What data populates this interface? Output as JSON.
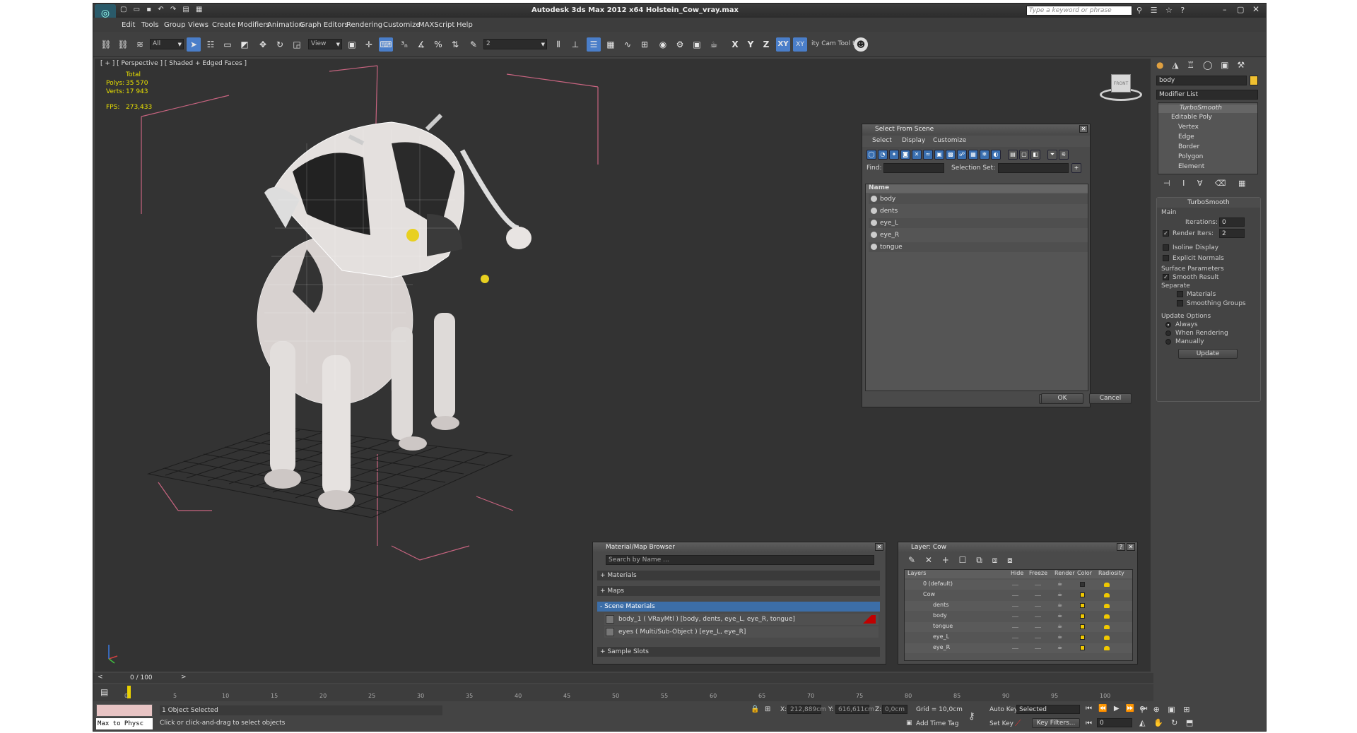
{
  "titlebar": {
    "title": "Autodesk 3ds Max  2012 x64     Holstein_Cow_vray.max",
    "search_placeholder": "Type a keyword or phrase"
  },
  "menu": [
    "Edit",
    "Tools",
    "Group",
    "Views",
    "Create",
    "Modifiers",
    "Animation",
    "Graph Editors",
    "Rendering",
    "Customize",
    "MAXScript",
    "Help"
  ],
  "toolbar": {
    "selection_filter": "All",
    "ref_coord": "View",
    "spinner_snap": "2",
    "axes": [
      "X",
      "Y",
      "Z",
      "XY",
      "XY"
    ],
    "cam_tool": "ity Cam Tool t"
  },
  "viewport": {
    "label": "[ + ] [ Perspective ] [ Shaded + Edged Faces ]",
    "stats": {
      "header": "Total",
      "polys_label": "Polys:",
      "polys": "35 570",
      "verts_label": "Verts:",
      "verts": "17 943",
      "fps_label": "FPS:",
      "fps": "273,433"
    },
    "viewcube_label": "FRONT"
  },
  "select_dialog": {
    "title": "Select From Scene",
    "menu": [
      "Select",
      "Display",
      "Customize"
    ],
    "find_label": "Find:",
    "find_value": "",
    "selset_label": "Selection Set:",
    "column": "Name",
    "items": [
      "body",
      "dents",
      "eye_L",
      "eye_R",
      "tongue"
    ],
    "ok": "OK",
    "cancel": "Cancel"
  },
  "material_browser": {
    "title": "Material/Map Browser",
    "search_placeholder": "Search by Name ...",
    "sections": [
      "+ Materials",
      "+ Maps",
      "- Scene Materials"
    ],
    "rows": [
      "body_1 ( VRayMtl ) [body, dents, eye_L, eye_R, tongue]",
      "eyes ( Multi/Sub-Object ) [eye_L, eye_R]"
    ],
    "sample_slots": "+ Sample Slots"
  },
  "layer_window": {
    "title": "Layer: Cow",
    "help": "?",
    "columns": [
      "Layers",
      "Hide",
      "Freeze",
      "Render",
      "Color",
      "Radiosity"
    ],
    "rows": [
      {
        "name": "0 (default)",
        "indent": 0
      },
      {
        "name": "Cow",
        "indent": 0
      },
      {
        "name": "dents",
        "indent": 1
      },
      {
        "name": "body",
        "indent": 1
      },
      {
        "name": "tongue",
        "indent": 1
      },
      {
        "name": "eye_L",
        "indent": 1
      },
      {
        "name": "eye_R",
        "indent": 1
      }
    ]
  },
  "command_panel": {
    "object_name": "body",
    "object_color": "#f0c030",
    "modifier_list": "Modifier List",
    "stack": [
      "TurboSmooth",
      "Editable Poly",
      "Vertex",
      "Edge",
      "Border",
      "Polygon",
      "Element"
    ],
    "rollout": "TurboSmooth",
    "main": "Main",
    "iterations_label": "Iterations:",
    "iterations": "0",
    "render_iters_label": "Render Iters:",
    "render_iters": "2",
    "isoline": "Isoline Display",
    "explicit": "Explicit Normals",
    "surface_params": "Surface Parameters",
    "smooth_result": "Smooth Result",
    "separate": "Separate",
    "materials": "Materials",
    "smoothing_groups": "Smoothing Groups",
    "update_options": "Update Options",
    "always": "Always",
    "when_rendering": "When Rendering",
    "manually": "Manually",
    "update": "Update"
  },
  "timeline": {
    "frame": "0 / 100",
    "ticks": [
      "0",
      "5",
      "10",
      "15",
      "20",
      "25",
      "30",
      "35",
      "40",
      "45",
      "50",
      "55",
      "60",
      "65",
      "70",
      "75",
      "80",
      "85",
      "90",
      "95",
      "100"
    ]
  },
  "statusbar": {
    "maxscript": "Max to Physc",
    "selected": "1 Object Selected",
    "prompt": "Click or click-and-drag to select objects",
    "x_label": "X:",
    "x": "212,889cm",
    "y_label": "Y:",
    "y": "616,611cm",
    "z_label": "Z:",
    "z": "0,0cm",
    "grid": "Grid = 10,0cm",
    "add_time_tag": "Add Time Tag",
    "auto_key": "Auto Key",
    "set_key": "Set Key",
    "key_mode": "Selected",
    "key_filters": "Key Filters...",
    "frame_field": "0"
  }
}
